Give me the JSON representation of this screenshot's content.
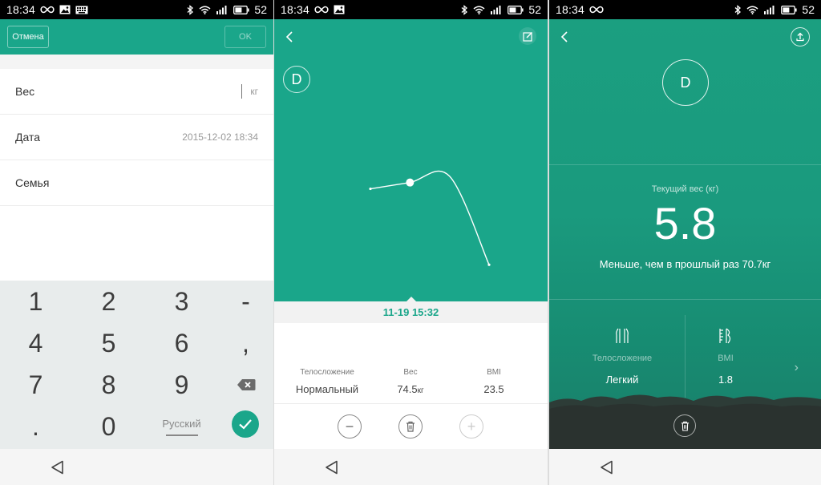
{
  "status": {
    "time": "18:34",
    "battery": "52"
  },
  "screen1": {
    "cancel_label": "Отмена",
    "ok_label": "OK",
    "rows": [
      {
        "label": "Вес",
        "value": "кг"
      },
      {
        "label": "Дата",
        "value": "2015-12-02 18:34"
      },
      {
        "label": "Семья",
        "value": ""
      }
    ],
    "keys": [
      "1",
      "2",
      "3",
      "-",
      "4",
      "5",
      "6",
      ",",
      "7",
      "8",
      "9",
      "0",
      "."
    ],
    "lang_label": "Русский"
  },
  "screen2": {
    "avatar_letter": "D",
    "date_label": "11-19 15:32",
    "stats": [
      {
        "label": "Телосложение",
        "value": "Нормальный"
      },
      {
        "label": "Вес",
        "value": "74.5",
        "unit": "кг"
      },
      {
        "label": "BMI",
        "value": "23.5"
      }
    ],
    "minus_label": "−",
    "plus_label": "+",
    "chart_data": {
      "type": "line",
      "x": [
        1,
        2,
        3,
        4
      ],
      "values": [
        74.0,
        74.5,
        75.0,
        68.0
      ],
      "selected_index": 1,
      "title": "",
      "xlabel": "",
      "ylabel": "",
      "grid": false
    }
  },
  "screen3": {
    "avatar_letter": "D",
    "current_label": "Текущий вес (кг)",
    "current_value": "5.8",
    "compare_text": "Меньше, чем в прошлый раз 70.7кг",
    "metrics": [
      {
        "label": "Телосложение",
        "value": "Легкий"
      },
      {
        "label": "BMI",
        "value": "1.8"
      }
    ]
  },
  "colors": {
    "accent": "#1aa68a",
    "accent_dark": "#178c72",
    "keypad_bg": "#e8ecec",
    "mountain": "#2f3a36"
  },
  "icons": {
    "status_left": [
      "infinity-icon",
      "image-icon",
      "keyboard-icon"
    ],
    "status_right": [
      "bluetooth-icon",
      "wifi-icon",
      "signal-icon",
      "battery-icon"
    ],
    "nav": "back-triangle-icon",
    "backspace": "backspace-icon",
    "confirm": "checkmark-icon",
    "edit": "edit-icon",
    "share": "upload-icon",
    "delete": "trash-icon",
    "body": "body-shape-icon",
    "bmi": "bmi-icon"
  }
}
